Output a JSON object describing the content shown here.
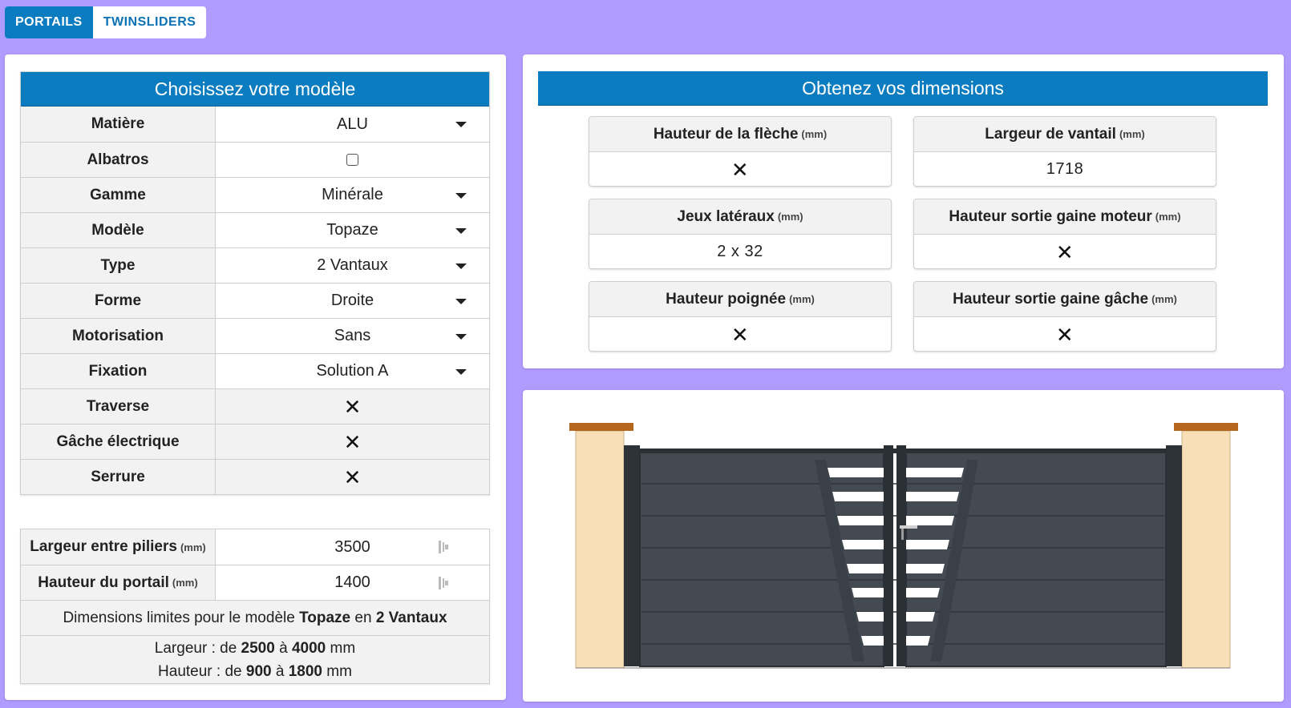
{
  "tabs": [
    {
      "label": "PORTAILS",
      "active": true
    },
    {
      "label": "TWINSLIDERS",
      "active": false
    }
  ],
  "model_panel": {
    "title": "Choisissez votre modèle",
    "rows": {
      "matiere": {
        "label": "Matière",
        "value": "ALU"
      },
      "albatros": {
        "label": "Albatros",
        "checked": false
      },
      "gamme": {
        "label": "Gamme",
        "value": "Minérale"
      },
      "modele": {
        "label": "Modèle",
        "value": "Topaze"
      },
      "type": {
        "label": "Type",
        "value": "2 Vantaux"
      },
      "forme": {
        "label": "Forme",
        "value": "Droite"
      },
      "motorisation": {
        "label": "Motorisation",
        "value": "Sans"
      },
      "fixation": {
        "label": "Fixation",
        "value": "Solution A"
      },
      "traverse": {
        "label": "Traverse",
        "value": "✕"
      },
      "gache": {
        "label": "Gâche électrique",
        "value": "✕"
      },
      "serrure": {
        "label": "Serrure",
        "value": "✕"
      }
    }
  },
  "dimensions_input": {
    "unit": "(mm)",
    "largeur": {
      "label": "Largeur entre piliers",
      "value": "3500"
    },
    "hauteur": {
      "label": "Hauteur du portail",
      "value": "1400"
    },
    "limits": {
      "prefix": "Dimensions limites pour le modèle",
      "model": "Topaze",
      "en": "en",
      "type": "2 Vantaux",
      "largeur_prefix": "Largeur : de",
      "largeur_min": "2500",
      "a": "à",
      "largeur_max": "4000",
      "mm": "mm",
      "hauteur_prefix": "Hauteur : de",
      "hauteur_min": "900",
      "hauteur_max": "1800"
    }
  },
  "dims_panel": {
    "title": "Obtenez vos dimensions",
    "unit": "(mm)",
    "boxes": [
      {
        "label": "Hauteur de la flèche",
        "value": "✕"
      },
      {
        "label": "Largeur de vantail",
        "value": "1718"
      },
      {
        "label": "Jeux latéraux",
        "value": "2 x 32"
      },
      {
        "label": "Hauteur sortie gaine moteur",
        "value": "✕"
      },
      {
        "label": "Hauteur poignée",
        "value": "✕"
      },
      {
        "label": "Hauteur sortie gaine gâche",
        "value": "✕"
      }
    ]
  },
  "colors": {
    "background": "#b09cff",
    "accent": "#0b7cbf",
    "gate": "#3a4047",
    "pillar": "#f9dfb7",
    "pillar_cap": "#b5651d"
  }
}
